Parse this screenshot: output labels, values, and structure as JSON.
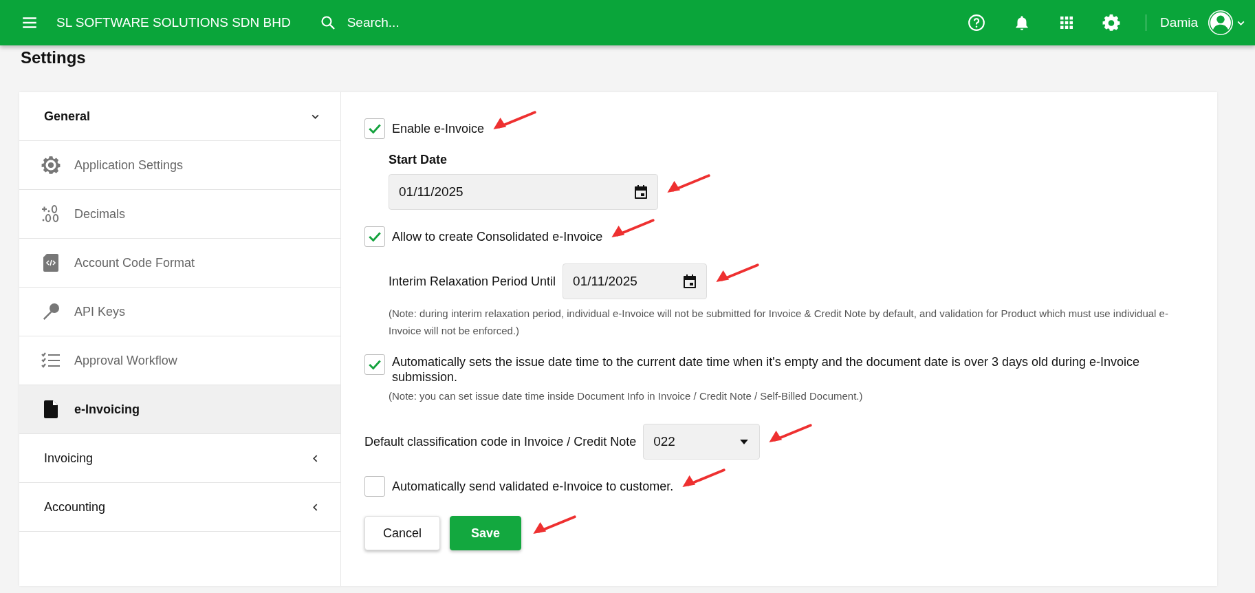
{
  "header": {
    "company": "SL SOFTWARE SOLUTIONS SDN BHD",
    "search": {
      "placeholder": "Search..."
    },
    "user": "Damia"
  },
  "page_title": "Settings",
  "sidebar": {
    "groups": [
      {
        "label": "General",
        "expanded": true,
        "items": [
          {
            "label": "Application Settings",
            "selected": false
          },
          {
            "label": "Decimals",
            "selected": false
          },
          {
            "label": "Account Code Format",
            "selected": false
          },
          {
            "label": "API Keys",
            "selected": false
          },
          {
            "label": "Approval Workflow",
            "selected": false
          },
          {
            "label": "e-Invoicing",
            "selected": true
          }
        ]
      },
      {
        "label": "Invoicing",
        "expanded": false
      },
      {
        "label": "Accounting",
        "expanded": false
      }
    ]
  },
  "form": {
    "enable": {
      "label": "Enable e-Invoice",
      "checked": true
    },
    "start_date": {
      "label": "Start Date",
      "value": "01/11/2025"
    },
    "consolidated": {
      "label": "Allow to create Consolidated e-Invoice",
      "checked": true
    },
    "interim": {
      "label": "Interim Relaxation Period Until",
      "value": "01/11/2025"
    },
    "interim_note": "(Note: during interim relaxation period, individual e-Invoice will not be submitted for Invoice & Credit Note by default, and validation for Product which must use individual e-Invoice will not be enforced.)",
    "auto_issue_date": {
      "label": "Automatically sets the issue date time to the current date time when it's empty and the document date is over 3 days old during e-Invoice submission.",
      "checked": true
    },
    "issue_note": "(Note: you can set issue date time inside Document Info in Invoice / Credit Note / Self-Billed Document.)",
    "classification": {
      "label": "Default classification code in Invoice / Credit Note",
      "value": "022"
    },
    "auto_send": {
      "label": "Automatically send validated e-Invoice to customer.",
      "checked": false
    },
    "buttons": [
      "Cancel",
      "Save"
    ]
  }
}
